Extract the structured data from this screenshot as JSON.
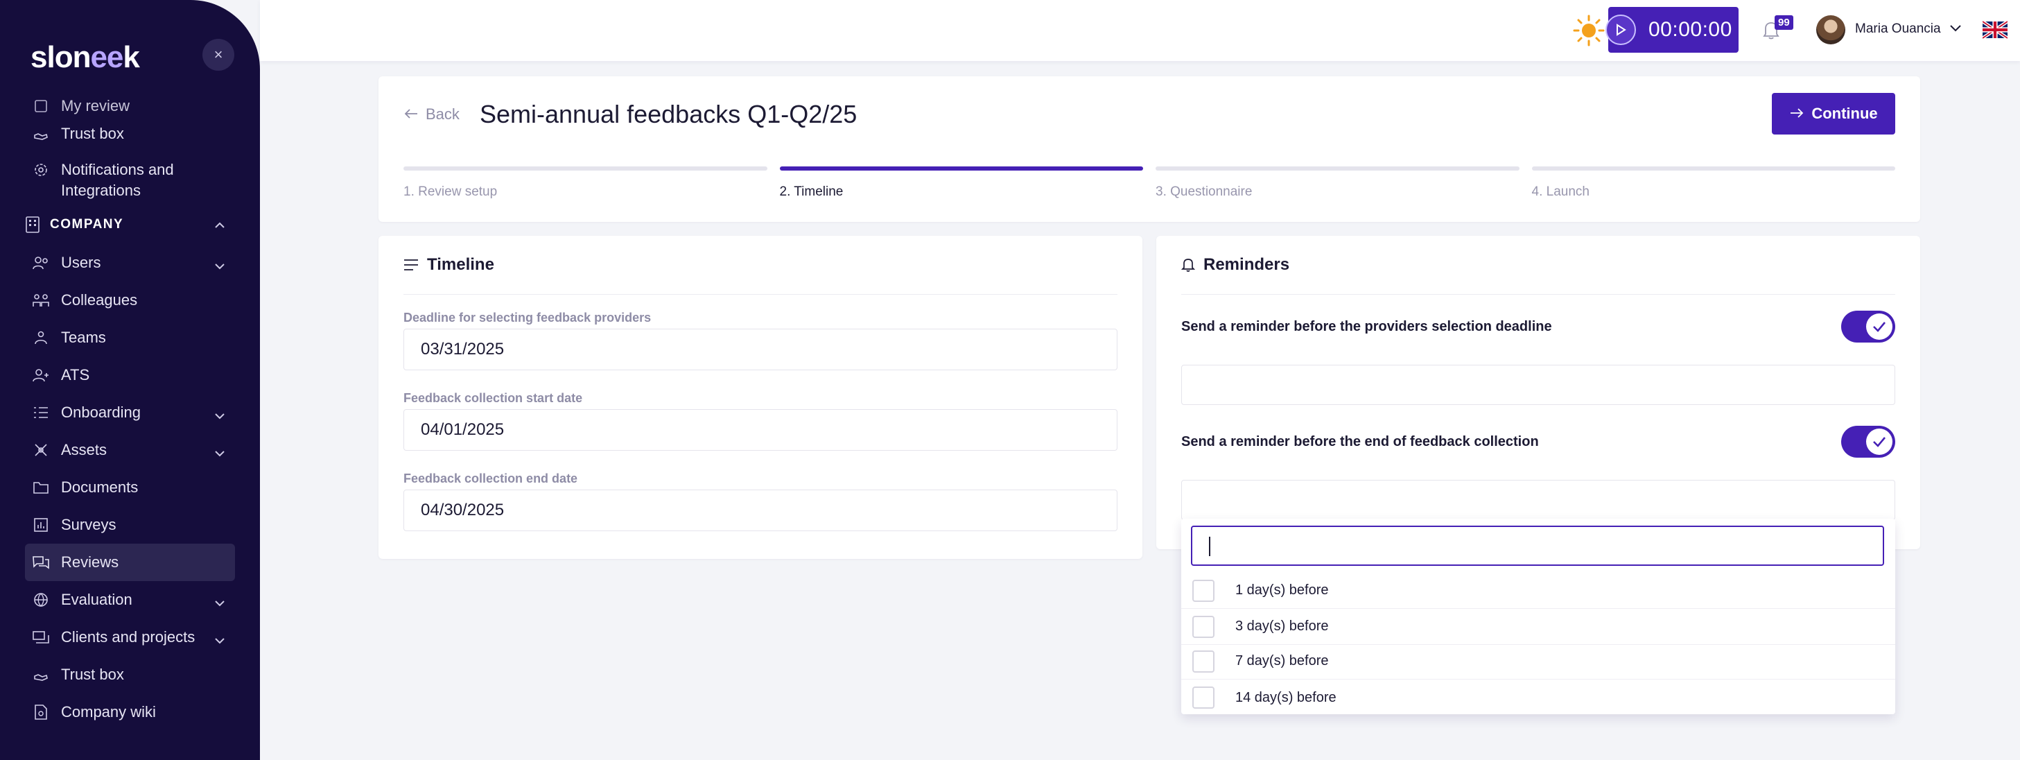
{
  "sidebar": {
    "logo": {
      "prefix": "slon",
      "loop": "ee",
      "suffix": "k"
    },
    "close_symbol": "×",
    "items_top": [
      {
        "label": "My review",
        "icon": "review-icon"
      },
      {
        "label": "Trust box",
        "icon": "trust-box-icon"
      },
      {
        "label": "Notifications and Integrations",
        "icon": "gear-icon"
      }
    ],
    "section": {
      "label": "COMPANY",
      "icon": "building-icon"
    },
    "items": [
      {
        "label": "Users",
        "icon": "users-icon",
        "expandable": true
      },
      {
        "label": "Colleagues",
        "icon": "colleagues-icon"
      },
      {
        "label": "Teams",
        "icon": "teams-icon"
      },
      {
        "label": "ATS",
        "icon": "ats-icon"
      },
      {
        "label": "Onboarding",
        "icon": "checklist-icon",
        "expandable": true
      },
      {
        "label": "Assets",
        "icon": "assets-icon",
        "expandable": true
      },
      {
        "label": "Documents",
        "icon": "folder-icon"
      },
      {
        "label": "Surveys",
        "icon": "chart-icon"
      },
      {
        "label": "Reviews",
        "icon": "chat-icon",
        "active": true
      },
      {
        "label": "Evaluation",
        "icon": "globe-icon",
        "expandable": true
      },
      {
        "label": "Clients and projects",
        "icon": "projects-icon",
        "expandable": true
      },
      {
        "label": "Trust box",
        "icon": "trust-box-icon"
      },
      {
        "label": "Company wiki",
        "icon": "wiki-icon"
      }
    ]
  },
  "topbar": {
    "timer": "00:00:00",
    "notification_count": "99",
    "user_name": "Maria Ouancia"
  },
  "header": {
    "back_label": "Back",
    "title": "Semi-annual feedbacks Q1-Q2/25",
    "continue_label": "Continue",
    "steps": [
      {
        "label": "1. Review setup",
        "active": false
      },
      {
        "label": "2. Timeline",
        "active": true
      },
      {
        "label": "3. Questionnaire",
        "active": false
      },
      {
        "label": "4. Launch",
        "active": false
      }
    ]
  },
  "timeline": {
    "title": "Timeline",
    "fields": [
      {
        "label": "Deadline for selecting feedback providers",
        "value": "03/31/2025"
      },
      {
        "label": "Feedback collection start date",
        "value": "04/01/2025"
      },
      {
        "label": "Feedback collection end date",
        "value": "04/30/2025"
      }
    ]
  },
  "reminders": {
    "title": "Reminders",
    "items": [
      {
        "label": "Send a reminder before the providers selection deadline",
        "enabled": true
      },
      {
        "label": "Send a reminder before the end of feedback collection",
        "enabled": true
      }
    ],
    "dropdown_options": [
      "1 day(s) before",
      "3 day(s) before",
      "7 day(s) before",
      "14 day(s) before"
    ]
  },
  "colors": {
    "accent": "#4520b5",
    "sidebar": "#150d3c",
    "background": "#f3f4f8"
  }
}
